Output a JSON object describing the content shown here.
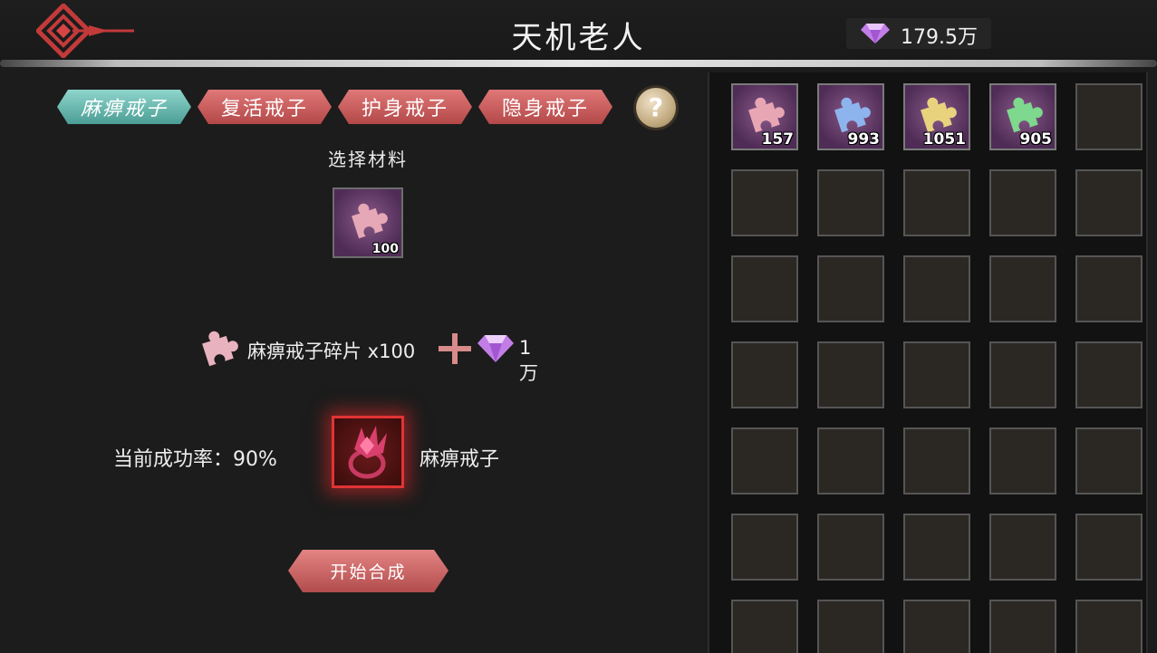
{
  "header": {
    "title": "天机老人",
    "currency_value": "179.5万"
  },
  "tabs": [
    {
      "label": "麻痹戒子",
      "active": true
    },
    {
      "label": "复活戒子",
      "active": false
    },
    {
      "label": "护身戒子",
      "active": false
    },
    {
      "label": "隐身戒子",
      "active": false
    }
  ],
  "help_label": "?",
  "materials": {
    "select_label": "选择材料",
    "selected_count": "100"
  },
  "recipe": {
    "fragment_text": "麻痹戒子碎片 x100",
    "diamond_cost": "1万"
  },
  "result": {
    "rate_text": "当前成功率：90%",
    "item_name": "麻痹戒子"
  },
  "craft_button": "开始合成",
  "inventory": {
    "items": [
      {
        "color": "#e8a6b4",
        "count": "157"
      },
      {
        "color": "#8eb4ee",
        "count": "993"
      },
      {
        "color": "#e8d27e",
        "count": "1051"
      },
      {
        "color": "#7ed88e",
        "count": "905"
      }
    ]
  },
  "colors": {
    "tab_active": "#5fb3aa",
    "tab_inactive": "#c65c5c",
    "result_glow": "#e03434"
  }
}
